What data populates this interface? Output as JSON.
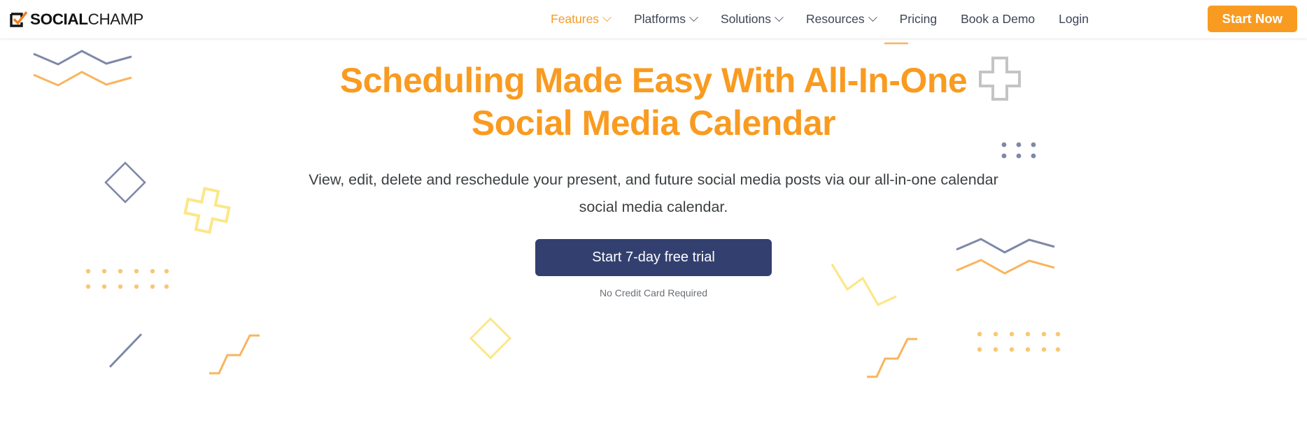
{
  "brand": {
    "logo_text_bold": "SOCIAL",
    "logo_text_light": "CHAMP",
    "logo_icon": "checkbox-check-icon",
    "accent_orange": "#F99B20",
    "navy": "#33406F",
    "slate": "#7E88A8",
    "yellow": "#FCE788",
    "gray": "#C4C4C4"
  },
  "header": {
    "nav": [
      {
        "label": "Features",
        "has_dropdown": true,
        "active": true
      },
      {
        "label": "Platforms",
        "has_dropdown": true,
        "active": false
      },
      {
        "label": "Solutions",
        "has_dropdown": true,
        "active": false
      },
      {
        "label": "Resources",
        "has_dropdown": true,
        "active": false
      },
      {
        "label": "Pricing",
        "has_dropdown": false,
        "active": false
      },
      {
        "label": "Book a Demo",
        "has_dropdown": false,
        "active": false
      },
      {
        "label": "Login",
        "has_dropdown": false,
        "active": false
      }
    ],
    "cta_label": "Start Now"
  },
  "hero": {
    "headline_line1": "Scheduling Made Easy With All-In-One",
    "headline_line2": "Social Media Calendar",
    "subtitle_line1": "View, edit, delete and reschedule your present, and future social media posts via our all-in-one calendar",
    "subtitle_line2": "social media calendar.",
    "cta_label": "Start 7-day free trial",
    "cta_note": "No Credit Card Required"
  },
  "decorations": [
    {
      "name": "zigzag-slate-top-left",
      "shape": "zigzag",
      "color": "#7E88A8"
    },
    {
      "name": "zigzag-orange-top-left",
      "shape": "zigzag",
      "color": "#F9B45E"
    },
    {
      "name": "diamond-slate-left",
      "shape": "diamond",
      "color": "#7E88A8"
    },
    {
      "name": "plus-yellow-left",
      "shape": "plus",
      "color": "#FCE788"
    },
    {
      "name": "dot-grid-yellow-left",
      "shape": "dots",
      "color": "#FCE788"
    },
    {
      "name": "diagonal-slate-bottom-left",
      "shape": "line",
      "color": "#7E88A8"
    },
    {
      "name": "step-orange-bottom-left",
      "shape": "step",
      "color": "#F9B45E"
    },
    {
      "name": "diamond-yellow-bottom",
      "shape": "diamond",
      "color": "#FCE788"
    },
    {
      "name": "plus-gray-top-right",
      "shape": "plus",
      "color": "#C4C4C4"
    },
    {
      "name": "dot-grid-slate-right",
      "shape": "dots",
      "color": "#7E88A8"
    },
    {
      "name": "zigzag-slate-right",
      "shape": "zigzag",
      "color": "#7E88A8"
    },
    {
      "name": "zigzag-orange-right",
      "shape": "zigzag",
      "color": "#F9B45E"
    },
    {
      "name": "zigzag-yellow-right",
      "shape": "zigzag",
      "color": "#FCE788"
    },
    {
      "name": "dot-grid-yellow-bottom-right",
      "shape": "dots",
      "color": "#FCE788"
    },
    {
      "name": "step-orange-bottom-right",
      "shape": "step",
      "color": "#F9B45E"
    },
    {
      "name": "dash-orange-top-right",
      "shape": "line",
      "color": "#F9B45E"
    }
  ]
}
